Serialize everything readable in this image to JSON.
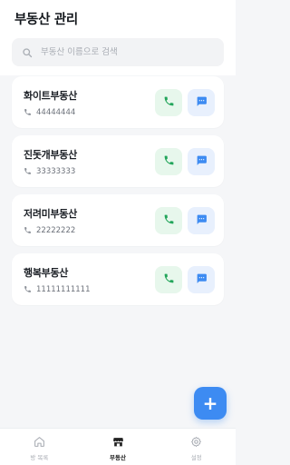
{
  "header": {
    "title": "부동산 관리"
  },
  "search": {
    "placeholder": "부동산 이름으로 검색"
  },
  "agencies": [
    {
      "name": "화이트부동산",
      "phone": "44444444"
    },
    {
      "name": "진돗개부동산",
      "phone": "33333333"
    },
    {
      "name": "저려미부동산",
      "phone": "22222222"
    },
    {
      "name": "행복부동산",
      "phone": "11111111111"
    }
  ],
  "fab": {
    "label": "+"
  },
  "nav": {
    "items": [
      {
        "label": "방 목록",
        "icon": "home-icon",
        "active": false
      },
      {
        "label": "부동산",
        "icon": "store-icon",
        "active": true
      },
      {
        "label": "설정",
        "icon": "gear-icon",
        "active": false
      }
    ]
  },
  "colors": {
    "call_icon": "#22a55a",
    "call_bg": "#e7f7ec",
    "message_icon": "#3d8bf2",
    "message_bg": "#e8f0fd",
    "accent": "#3d8bf2"
  }
}
